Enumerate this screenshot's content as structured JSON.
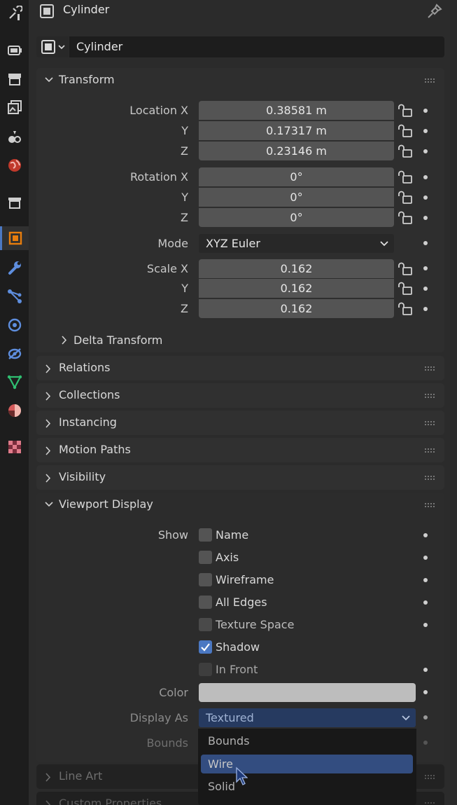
{
  "header": {
    "title": "Cylinder"
  },
  "name_field": {
    "value": "Cylinder"
  },
  "transform": {
    "title": "Transform",
    "location_label": "Location X",
    "axis_y": "Y",
    "axis_z": "Z",
    "location": [
      "0.38581 m",
      "0.17317 m",
      "0.23146 m"
    ],
    "rotation_label": "Rotation X",
    "rotation": [
      "0°",
      "0°",
      "0°"
    ],
    "mode_label": "Mode",
    "mode_value": "XYZ Euler",
    "scale_label": "Scale X",
    "scale": [
      "0.162",
      "0.162",
      "0.162"
    ],
    "delta": "Delta Transform"
  },
  "sections": {
    "relations": "Relations",
    "collections": "Collections",
    "instancing": "Instancing",
    "motion_paths": "Motion Paths",
    "visibility": "Visibility",
    "viewport_display": "Viewport Display",
    "line_art": "Line Art",
    "custom_properties": "Custom Properties"
  },
  "viewport": {
    "show_label": "Show",
    "options": [
      {
        "label": "Name",
        "checked": false
      },
      {
        "label": "Axis",
        "checked": false
      },
      {
        "label": "Wireframe",
        "checked": false
      },
      {
        "label": "All Edges",
        "checked": false
      },
      {
        "label": "Texture Space",
        "checked": false
      },
      {
        "label": "Shadow",
        "checked": true
      },
      {
        "label": "In Front",
        "checked": false
      }
    ],
    "color_label": "Color",
    "color_value": "#bdbdbd",
    "display_as_label": "Display As",
    "display_as_value": "Textured",
    "bounds_label": "Bounds"
  },
  "menu": {
    "items": [
      "Bounds",
      "Wire",
      "Solid"
    ],
    "highlighted": "Wire"
  },
  "colors": {
    "accent": "#4b78c2",
    "highlight": "#334d80",
    "active_tab": "#e87d0d"
  }
}
